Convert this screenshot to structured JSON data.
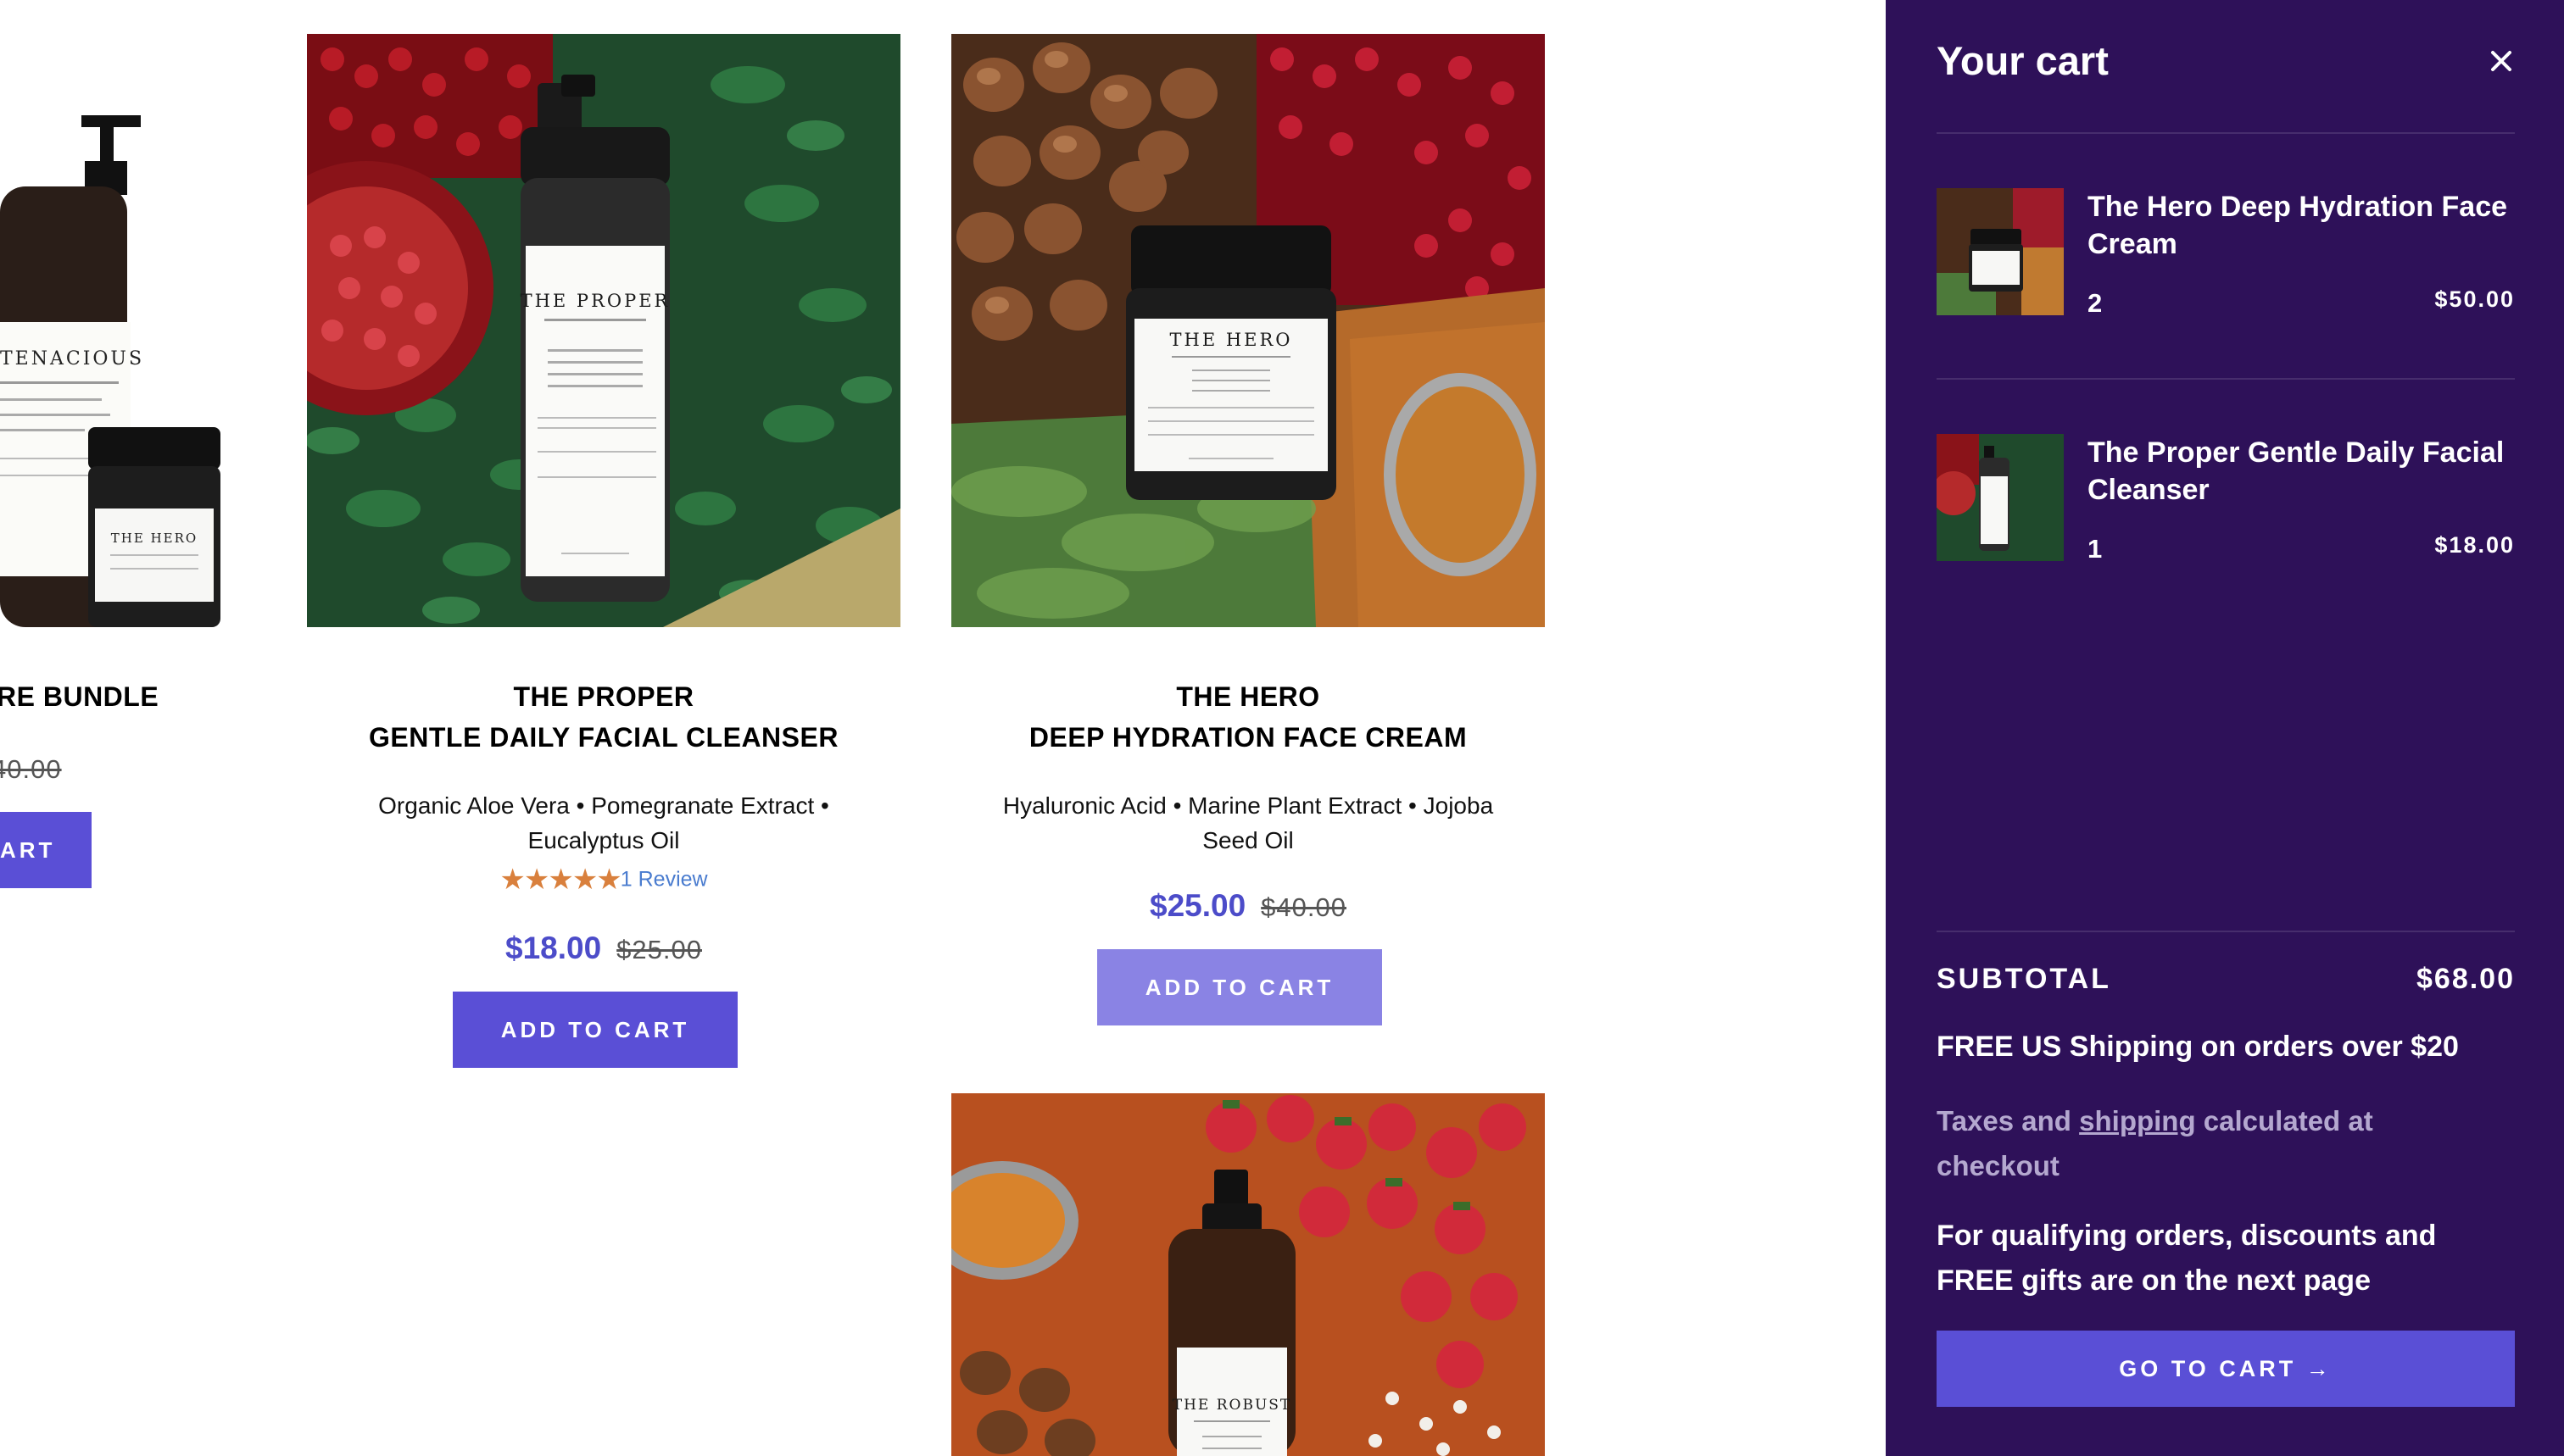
{
  "products": {
    "bundle": {
      "title_line1": "RE BUNDLE",
      "compare_price": "40.00",
      "button_label": "ART"
    },
    "proper": {
      "title_line1": "THE PROPER",
      "title_line2": "GENTLE DAILY FACIAL CLEANSER",
      "ingredients": "Organic Aloe Vera • Pomegranate Extract • Eucalyptus Oil",
      "stars": "★★★★★",
      "rating_value": 5,
      "reviews": "1 Review",
      "price": "$18.00",
      "compare_price": "$25.00",
      "button_label": "ADD TO CART"
    },
    "hero": {
      "title_line1": "THE HERO",
      "title_line2": "DEEP HYDRATION FACE CREAM",
      "ingredients": "Hyaluronic Acid • Marine Plant Extract • Jojoba Seed Oil",
      "price": "$25.00",
      "compare_price": "$40.00",
      "button_label": "ADD TO CART"
    },
    "image_labels": {
      "tenacious_brand": "TENACIOUS",
      "proper_brand": "THE PROPER",
      "hero_brand": "THE HERO",
      "robust_brand": "THE ROBUST"
    }
  },
  "cart": {
    "title": "Your cart",
    "items": [
      {
        "name": "The Hero Deep Hydration Face Cream",
        "qty": "2",
        "price": "$50.00"
      },
      {
        "name": "The Proper Gentle Daily Facial Cleanser",
        "qty": "1",
        "price": "$18.00"
      }
    ],
    "subtotal_label": "SUBTOTAL",
    "subtotal_value": "$68.00",
    "shipping_note": "FREE US Shipping on orders over $20",
    "tax_prefix": "Taxes and ",
    "tax_link": "shipping",
    "tax_suffix": " calculated at checkout",
    "discount_note": "For qualifying orders, discounts and FREE gifts are on the next page",
    "go_to_cart_label": "GO TO CART →"
  },
  "colors": {
    "accent": "#5a4fd6",
    "accent_light": "#8a83e4",
    "drawer_bg": "#2e1159",
    "price": "#4c4cc9",
    "star": "#d9803d",
    "review_link": "#4a7ccf"
  },
  "icons": [
    "close-icon"
  ]
}
